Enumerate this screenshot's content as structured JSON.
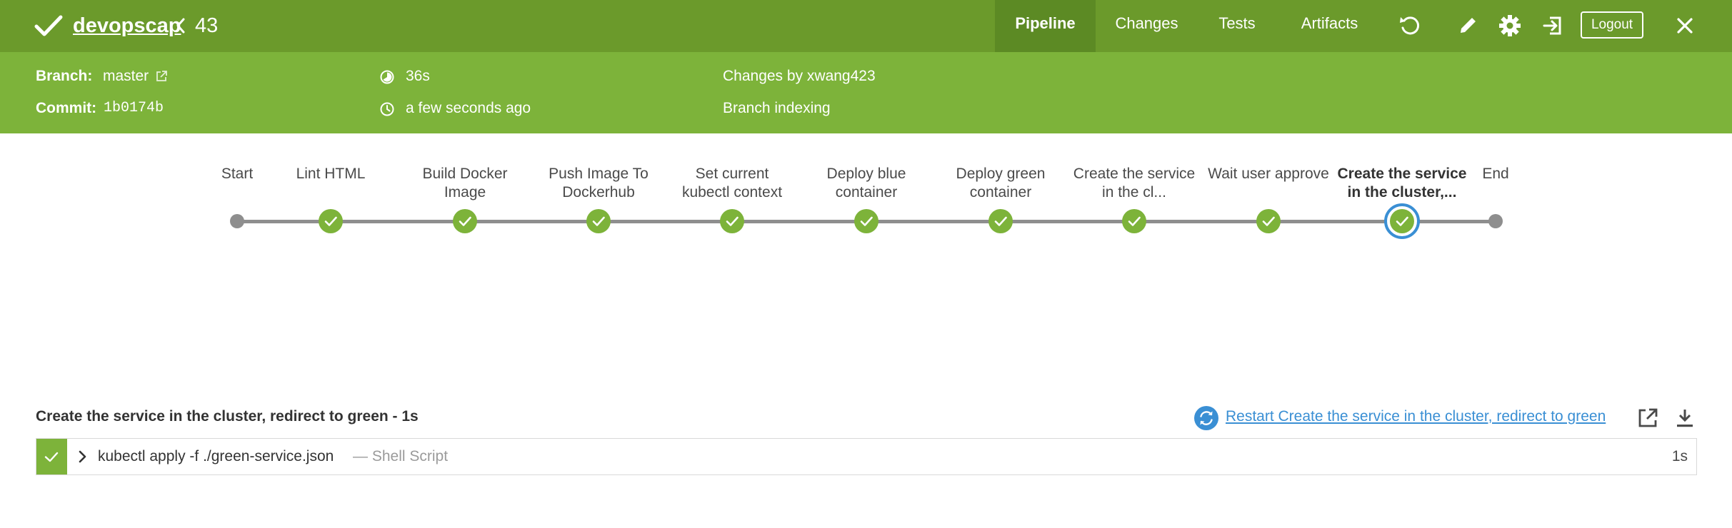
{
  "header": {
    "pipeline_name": "devopscap",
    "run_number": "43",
    "tabs": [
      "Pipeline",
      "Changes",
      "Tests",
      "Artifacts"
    ],
    "active_tab": "Pipeline",
    "logout_label": "Logout",
    "icons": [
      "check-icon",
      "chevron-left-icon",
      "rerun-icon",
      "edit-icon",
      "gear-icon",
      "exit-classic-icon",
      "close-icon"
    ]
  },
  "info": {
    "branch_label": "Branch:",
    "branch_value": "master",
    "commit_label": "Commit:",
    "commit_value": "1b0174b",
    "duration": "36s",
    "time_ago": "a few seconds ago",
    "changes": "Changes by xwang423",
    "cause": "Branch indexing"
  },
  "stages": [
    {
      "line1": "",
      "line2": "Start",
      "status": "start"
    },
    {
      "line1": "",
      "line2": "Lint HTML",
      "status": "success"
    },
    {
      "line1": "Build Docker",
      "line2": "Image",
      "status": "success"
    },
    {
      "line1": "Push Image To",
      "line2": "Dockerhub",
      "status": "success"
    },
    {
      "line1": "Set current",
      "line2": "kubectl context",
      "status": "success"
    },
    {
      "line1": "Deploy blue",
      "line2": "container",
      "status": "success"
    },
    {
      "line1": "Deploy green",
      "line2": "container",
      "status": "success"
    },
    {
      "line1": "Create the service",
      "line2": "in the cl...",
      "status": "success"
    },
    {
      "line1": "",
      "line2": "Wait user approve",
      "status": "success"
    },
    {
      "line1": "Create the service",
      "line2": "in the cluster,...",
      "status": "success-selected"
    },
    {
      "line1": "",
      "line2": "End",
      "status": "end"
    }
  ],
  "step_detail": {
    "title": "Create the service in the cluster, redirect to green - 1s",
    "restart_label": "Restart Create the service in the cluster, redirect to green",
    "log": {
      "command": "kubectl apply -f ./green-service.json",
      "type": "— Shell Script",
      "duration": "1s",
      "status": "success"
    }
  },
  "colors": {
    "header_bg": "#6b9a2b",
    "info_bg": "#7db33a",
    "success": "#7db33a",
    "selected_ring": "#3a8fd4",
    "link": "#3a8fd4"
  }
}
